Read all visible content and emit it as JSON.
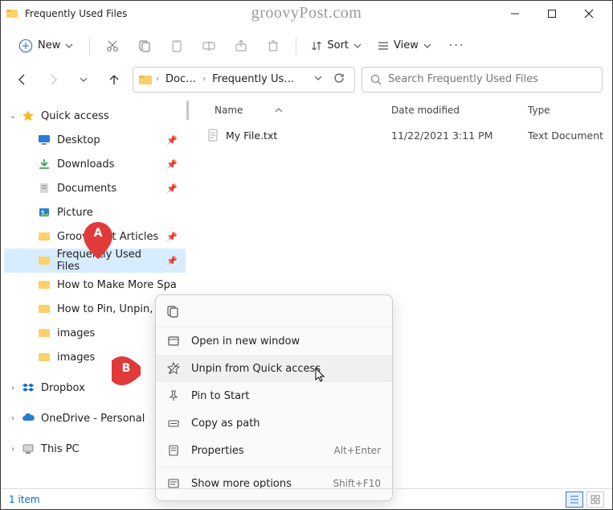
{
  "watermark": "groovyPost.com",
  "window": {
    "title": "Frequently Used Files"
  },
  "toolbar": {
    "new_label": "New",
    "sort_label": "Sort",
    "view_label": "View"
  },
  "breadcrumbs": {
    "c1": "Doc…",
    "c2": "Frequently Us…"
  },
  "search": {
    "placeholder": "Search Frequently Used Files"
  },
  "sidebar": {
    "quick_access": "Quick access",
    "items": [
      {
        "label": "Desktop"
      },
      {
        "label": "Downloads"
      },
      {
        "label": "Documents"
      },
      {
        "label": "Picture"
      },
      {
        "label": "GroovyPost Articles"
      },
      {
        "label": "Frequently Used Files"
      },
      {
        "label": "How to Make More Spa"
      },
      {
        "label": "How to Pin, Unpin, Hid"
      },
      {
        "label": "images"
      },
      {
        "label": "images"
      }
    ],
    "dropbox": "Dropbox",
    "onedrive": "OneDrive - Personal",
    "thispc": "This PC"
  },
  "columns": {
    "name": "Name",
    "date": "Date modified",
    "type": "Type"
  },
  "files": [
    {
      "name": "My File.txt",
      "date": "11/22/2021 3:11 PM",
      "type": "Text Document"
    }
  ],
  "status": {
    "count": "1 item"
  },
  "context_menu": {
    "open_new_window": "Open in new window",
    "unpin": "Unpin from Quick access",
    "pin_start": "Pin to Start",
    "copy_path": "Copy as path",
    "properties": "Properties",
    "properties_shortcut": "Alt+Enter",
    "show_more": "Show more options",
    "show_more_shortcut": "Shift+F10"
  },
  "markers": {
    "a": "A",
    "b": "B"
  }
}
